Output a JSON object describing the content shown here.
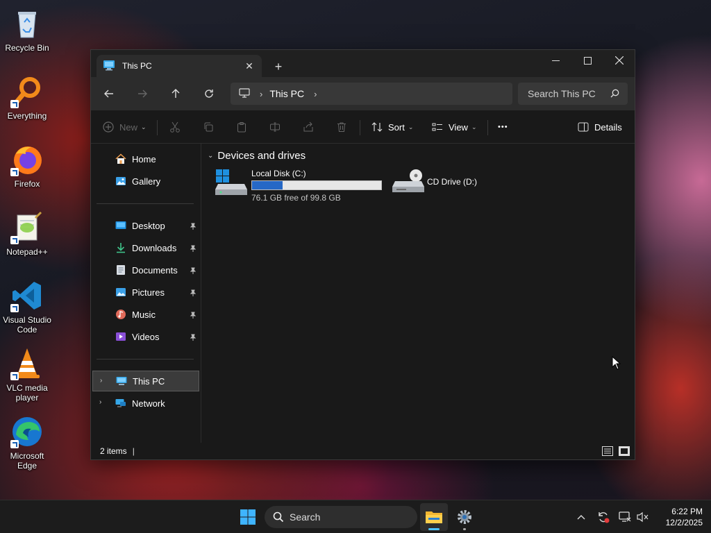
{
  "desktop": {
    "icons": [
      {
        "label": "Recycle Bin",
        "icon": "recycle-bin-icon"
      },
      {
        "label": "Everything",
        "icon": "magnifier-icon"
      },
      {
        "label": "Firefox",
        "icon": "firefox-icon"
      },
      {
        "label": "Notepad++",
        "icon": "notepadpp-icon"
      },
      {
        "label": "Visual Studio Code",
        "icon": "vscode-icon"
      },
      {
        "label": "VLC media player",
        "icon": "vlc-icon"
      },
      {
        "label": "Microsoft Edge",
        "icon": "edge-icon"
      }
    ]
  },
  "window": {
    "tab_title": "This PC",
    "tab_close": "✕",
    "new_tab": "+",
    "controls": {
      "minimize": "—",
      "maximize": "☐",
      "close": "✕"
    }
  },
  "navbar": {
    "breadcrumb": [
      "This PC"
    ],
    "search_placeholder": "Search This PC"
  },
  "toolbar": {
    "new_label": "New",
    "sort_label": "Sort",
    "view_label": "View",
    "more_label": "•••",
    "details_label": "Details"
  },
  "sidebar": {
    "quick": [
      {
        "label": "Home",
        "icon": "home-icon"
      },
      {
        "label": "Gallery",
        "icon": "gallery-icon"
      }
    ],
    "pinned": [
      {
        "label": "Desktop",
        "icon": "desktop-folder-icon"
      },
      {
        "label": "Downloads",
        "icon": "downloads-icon"
      },
      {
        "label": "Documents",
        "icon": "documents-icon"
      },
      {
        "label": "Pictures",
        "icon": "pictures-icon"
      },
      {
        "label": "Music",
        "icon": "music-icon"
      },
      {
        "label": "Videos",
        "icon": "videos-icon"
      }
    ],
    "locations": [
      {
        "label": "This PC",
        "icon": "this-pc-icon",
        "selected": true
      },
      {
        "label": "Network",
        "icon": "network-icon",
        "selected": false
      }
    ]
  },
  "content": {
    "group_title": "Devices and drives",
    "drives": [
      {
        "name": "Local Disk (C:)",
        "free_text": "76.1 GB free of 99.8 GB",
        "used_fraction": 0.237
      },
      {
        "name": "CD Drive (D:)"
      }
    ]
  },
  "statusbar": {
    "items_text": "2 items",
    "caret": "|"
  },
  "taskbar": {
    "search_label": "Search",
    "time": "6:22 PM",
    "date": "12/2/2025"
  },
  "colors": {
    "accent": "#2668c6",
    "window_bg": "#191919",
    "taskbar_bg": "#1c1c1c"
  }
}
